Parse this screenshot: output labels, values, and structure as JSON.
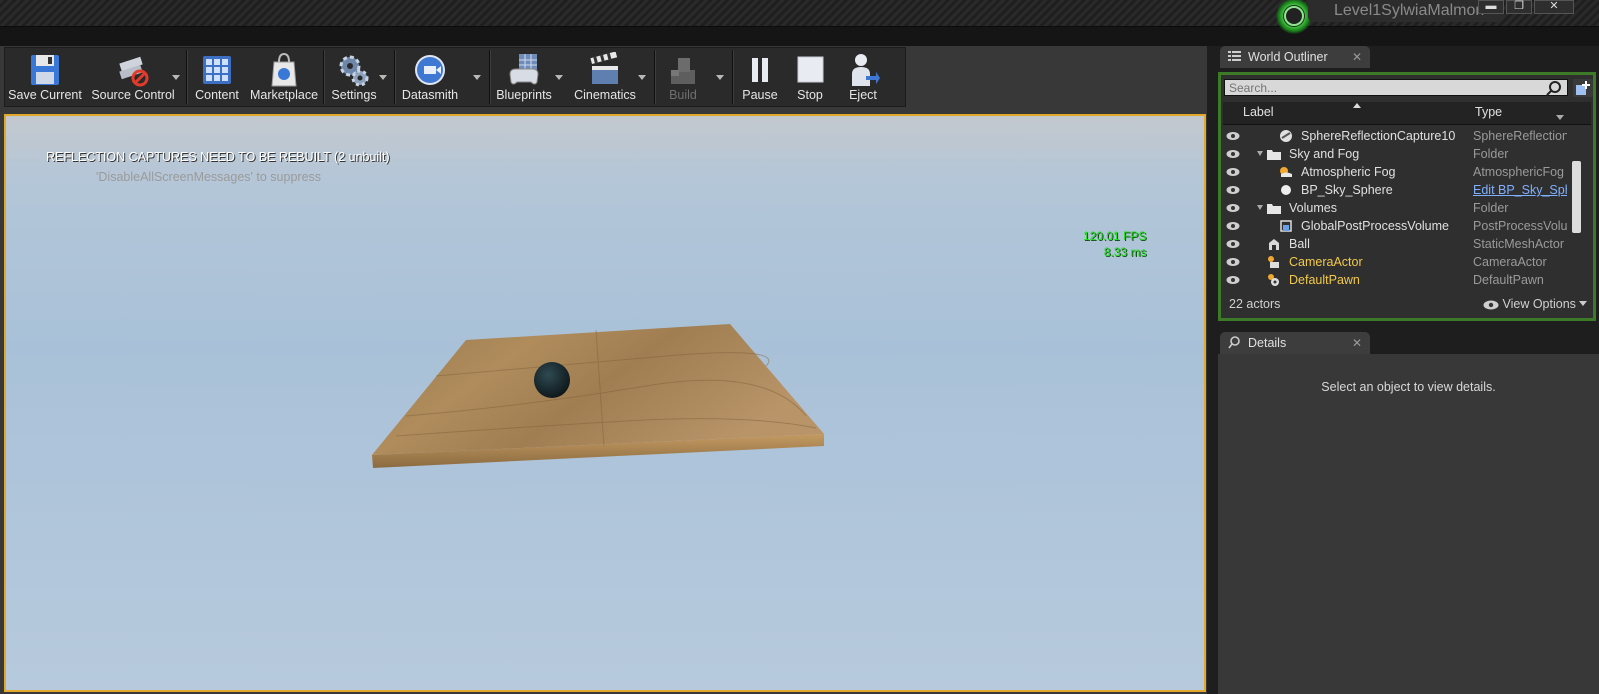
{
  "window": {
    "project_name": "Level1SylwiaMalmon",
    "minimize_glyph": "▬",
    "restore_glyph": "❐",
    "close_glyph": "✕"
  },
  "toolbar": {
    "items": [
      {
        "label": "Save Current",
        "icon": "floppy-disk-icon"
      },
      {
        "label": "Source Control",
        "icon": "source-control-icon"
      },
      {
        "label": "Content",
        "icon": "content-browser-icon"
      },
      {
        "label": "Marketplace",
        "icon": "marketplace-bag-icon"
      },
      {
        "label": "Settings",
        "icon": "gears-icon"
      },
      {
        "label": "Datasmith",
        "icon": "datasmith-icon"
      },
      {
        "label": "Blueprints",
        "icon": "gamepad-icon"
      },
      {
        "label": "Cinematics",
        "icon": "clapperboard-icon"
      },
      {
        "label": "Build",
        "icon": "build-blocks-icon",
        "disabled": true
      },
      {
        "label": "Pause",
        "icon": "pause-icon"
      },
      {
        "label": "Stop",
        "icon": "stop-icon"
      },
      {
        "label": "Eject",
        "icon": "eject-person-icon"
      }
    ]
  },
  "viewport": {
    "warning": "REFLECTION CAPTURES NEED TO BE REBUILT (2 unbuilt)",
    "hint": "'DisableAllScreenMessages' to suppress",
    "fps": "120.01 FPS",
    "ms": "8.33 ms",
    "border_color": "#e2a82b",
    "fps_color": "#24e024"
  },
  "outliner": {
    "tab_label": "World Outliner",
    "close_glyph": "✕",
    "search_placeholder": "Search...",
    "columns": {
      "label": "Label",
      "type": "Type"
    },
    "rows": [
      {
        "label": "SphereReflectionCapture10",
        "type": "SphereReflectionC",
        "indent": 2,
        "icon": "reflection-capture-icon"
      },
      {
        "label": "Sky and Fog",
        "type": "Folder",
        "indent": 1,
        "icon": "folder-icon",
        "expanded": true
      },
      {
        "label": "Atmospheric Fog",
        "type": "AtmosphericFog",
        "indent": 2,
        "icon": "fog-icon"
      },
      {
        "label": "BP_Sky_Sphere",
        "type": "Edit BP_Sky_Sph",
        "indent": 2,
        "icon": "sphere-icon",
        "type_link": true
      },
      {
        "label": "Volumes",
        "type": "Folder",
        "indent": 1,
        "icon": "folder-icon",
        "expanded": true
      },
      {
        "label": "GlobalPostProcessVolume",
        "type": "PostProcessVolu",
        "indent": 2,
        "icon": "volume-icon"
      },
      {
        "label": "Ball",
        "type": "StaticMeshActor",
        "indent": 1,
        "icon": "static-mesh-icon"
      },
      {
        "label": "CameraActor",
        "type": "CameraActor",
        "indent": 1,
        "icon": "camera-icon",
        "highlight": true
      },
      {
        "label": "DefaultPawn",
        "type": "DefaultPawn",
        "indent": 1,
        "icon": "pawn-icon",
        "highlight": true
      }
    ],
    "actor_count": "22 actors",
    "view_options": "View Options",
    "highlight_color": "#f2c94c",
    "accent_color": "#3c7a28"
  },
  "details": {
    "tab_label": "Details",
    "close_glyph": "✕",
    "empty_message": "Select an object to view details."
  }
}
